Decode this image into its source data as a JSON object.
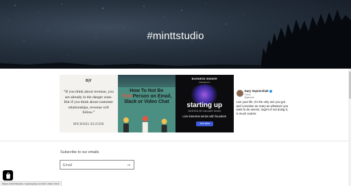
{
  "hero": {
    "title": "#minttstudio"
  },
  "instagram": {
    "tiles": [
      {
        "brand": "B|F",
        "quote": "“If you think about revenue, you are already in the danger zone. But if you think about customer relationships, revenue will follow.”",
        "author": "MICHAEL KLIGER"
      },
      {
        "headline_line1": "How To Not Be",
        "headline_highlight": "That",
        "headline_line2": "Person on Email, Slack or Video Chat"
      },
      {
        "publisher": "BUSINESS INSIDER",
        "publisher_sub": "PRESENTS",
        "show": "starting up",
        "host": "HOSTED BY DALAKE SHAH",
        "tagline": "Live interview series with founders",
        "cta": "Join Now"
      },
      {
        "name": "Gary Vaynerchuk",
        "handle1": "Follow",
        "handle2": "@garyvee",
        "tweet": "Live your life, it's the only one you got and I promise as scary as whatever you want to do seems, regret of not doing it, is much scarier."
      }
    ]
  },
  "newsletter": {
    "heading": "Subscribe to our emails",
    "email_placeholder": "Email",
    "submit_icon": "arrow-right-icon"
  },
  "status_bar": {
    "url": "https://minttstudio.myshopify.com/#0 visits feed"
  },
  "colors": {
    "accent_highlight": "#e8563a",
    "join_button": "#3d5bd9",
    "verified": "#1d9bf0"
  }
}
